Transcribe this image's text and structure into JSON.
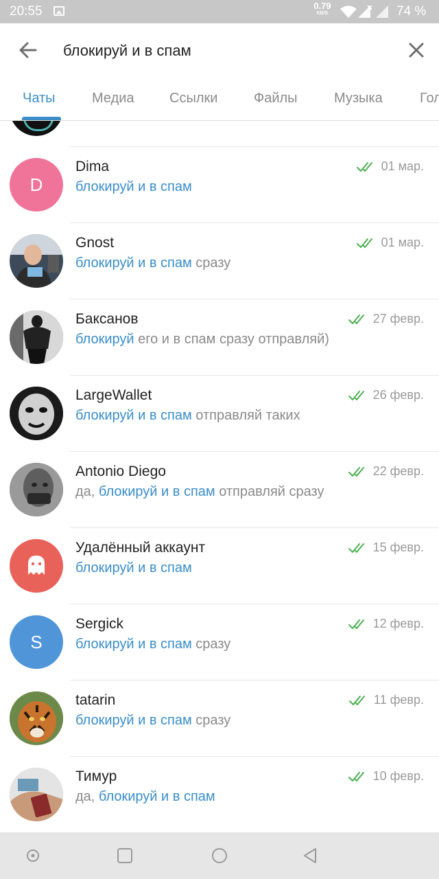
{
  "status_bar": {
    "time": "20:55",
    "net_speed": "0.79",
    "net_unit": "KB/S",
    "battery": "74 %"
  },
  "search": {
    "query": "блокируй и в спам"
  },
  "tabs": [
    {
      "label": "Чаты",
      "active": true
    },
    {
      "label": "Медиа",
      "active": false
    },
    {
      "label": "Ссылки",
      "active": false
    },
    {
      "label": "Файлы",
      "active": false
    },
    {
      "label": "Музыка",
      "active": false
    },
    {
      "label": "Голосовые",
      "active": false
    }
  ],
  "chats": [
    {
      "name": "Dima",
      "date": "01 мар.",
      "msg_pre": "",
      "msg_hl": "блокируй и в спам",
      "msg_post": "",
      "avatar": {
        "type": "letter",
        "letter": "D",
        "color": "#f0739a"
      }
    },
    {
      "name": "Gnost",
      "date": "01 мар.",
      "msg_pre": "",
      "msg_hl": "блокируй и в спам",
      "msg_post": " сразу",
      "avatar": {
        "type": "photo",
        "color": "#8a8f9a"
      }
    },
    {
      "name": "Баксанов",
      "date": "27 февр.",
      "msg_pre": "",
      "msg_hl": "блокируй",
      "msg_post": " его и в спам сразу отправляй)",
      "avatar": {
        "type": "photo",
        "color": "#3a3a3a"
      }
    },
    {
      "name": "LargeWallet",
      "date": "26 февр.",
      "msg_pre": "",
      "msg_hl": "блокируй и в спам",
      "msg_post": " отправляй таких",
      "avatar": {
        "type": "photo",
        "color": "#2b2b2b"
      }
    },
    {
      "name": "Antonio Diego",
      "date": "22 февр.",
      "msg_pre": "да, ",
      "msg_hl": "блокируй и в спам",
      "msg_post": " отправляй сразу",
      "avatar": {
        "type": "photo",
        "color": "#5a5a5a"
      }
    },
    {
      "name": "Удалённый аккаунт",
      "date": "15 февр.",
      "msg_pre": "",
      "msg_hl": "блокируй и в спам",
      "msg_post": "",
      "avatar": {
        "type": "ghost",
        "color": "#e8625a"
      }
    },
    {
      "name": "Sergick",
      "date": "12 февр.",
      "msg_pre": "",
      "msg_hl": "блокируй и в спам",
      "msg_post": " сразу",
      "avatar": {
        "type": "letter",
        "letter": "S",
        "color": "#4f95d8"
      }
    },
    {
      "name": "tatarin",
      "date": "11 февр.",
      "msg_pre": "",
      "msg_hl": "блокируй и в спам",
      "msg_post": " сразу",
      "avatar": {
        "type": "photo",
        "color": "#8a5a30"
      }
    },
    {
      "name": "Тимур",
      "date": "10 февр.",
      "msg_pre": "да, ",
      "msg_hl": "блокируй и в спам",
      "msg_post": "",
      "avatar": {
        "type": "photo",
        "color": "#b58a6a"
      }
    }
  ],
  "colors": {
    "accent": "#3a8dc9",
    "read_check": "#4caf50",
    "secondary_text": "#8a8a8a"
  }
}
